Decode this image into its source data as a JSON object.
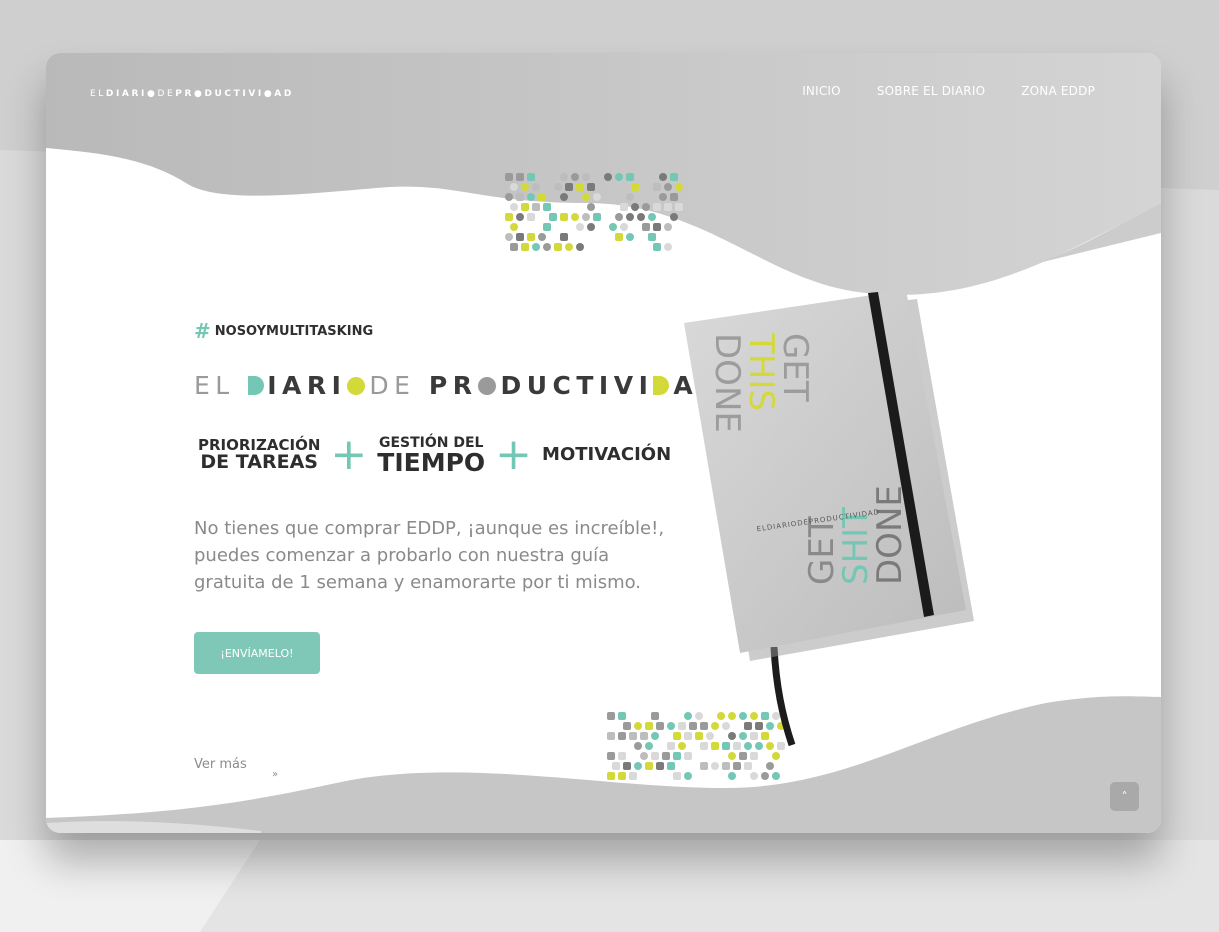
{
  "header": {
    "logo": {
      "p1": "EL",
      "p2": "DIARI",
      "p3": "DE",
      "p4": "PR",
      "p5": "DUCTIVI",
      "p6": "AD"
    },
    "nav": [
      {
        "label": "INICIO"
      },
      {
        "label": "SOBRE EL DIARIO"
      },
      {
        "label": "ZONA EDDP"
      }
    ]
  },
  "hero": {
    "hashtag": "NOSOYMULTITASKING",
    "hash_symbol": "#",
    "big_logo": {
      "p1": "EL",
      "p2": "IARI",
      "p3": "DE",
      "p4": "PR",
      "p5": "DUCTIVI",
      "p6": "AD"
    },
    "formula": {
      "term1_line1": "PRIORIZACIÓN",
      "term1_line2": "DE TAREAS",
      "term2_line1": "GESTIÓN DEL",
      "term2_line2": "TIEMPO",
      "term3": "MOTIVACIÓN",
      "plus": "+"
    },
    "description": "No tienes que comprar EDDP, ¡aunque es increíble!, puedes comenzar a probarlo con nuestra guía gratuita de 1 semana y enamorarte por ti mismo.",
    "cta_label": "¡ENVÍAMELO!",
    "see_more": "Ver más",
    "see_more_icon": "double-chevron-down-icon"
  },
  "notebook": {
    "cover_top": [
      "GET",
      "THIS",
      "DONE"
    ],
    "cover_bottom": [
      "GET",
      "SHIT",
      "DONE"
    ],
    "spine_logo": "ELDIARIODEPRODUCTIVIDAD"
  },
  "scroll_top_icon": "chevron-up-icon",
  "colors": {
    "accent_teal": "#74c7b4",
    "accent_yellow": "#d4d93a",
    "gray_wave": "#c9c9c9",
    "text_dark": "#2e2e2e",
    "text_gray": "#8a8a8a"
  }
}
